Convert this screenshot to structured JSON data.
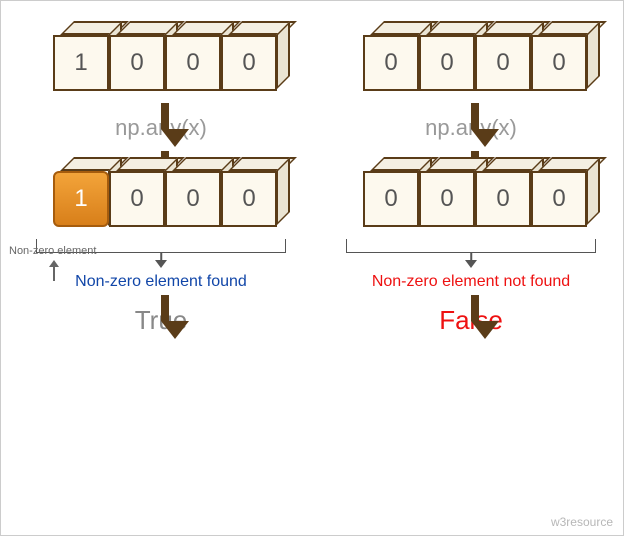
{
  "chart_data": {
    "type": "table",
    "function": "np.any(x)",
    "left": {
      "input": [
        1,
        0,
        0,
        0
      ],
      "output": [
        1,
        0,
        0,
        0
      ],
      "highlight_index": 0,
      "caption": "Non-zero element found",
      "result": "True"
    },
    "right": {
      "input": [
        0,
        0,
        0,
        0
      ],
      "output": [
        0,
        0,
        0,
        0
      ],
      "highlight_index": null,
      "caption": "Non-zero element not found",
      "result": "False"
    }
  },
  "labels": {
    "fn": "np.any(x)",
    "nonzero_pointer": "Non-zero element",
    "watermark": "w3resource"
  }
}
